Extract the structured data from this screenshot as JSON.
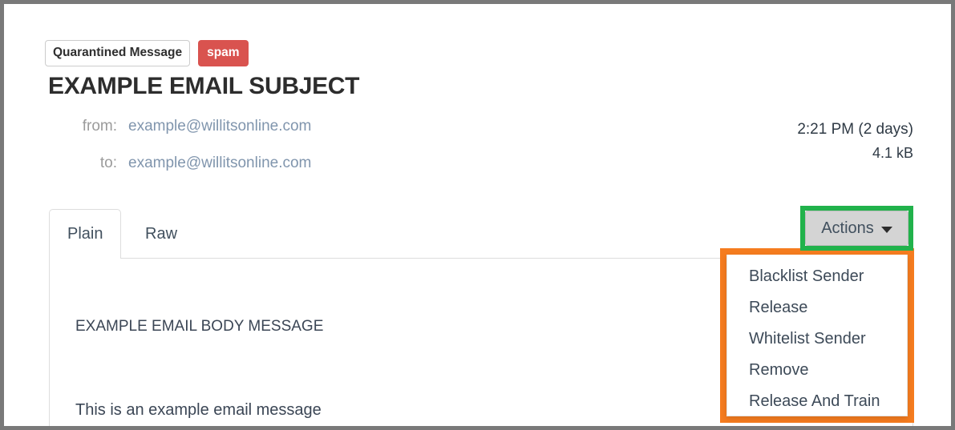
{
  "window": {
    "frame_color": "#797979",
    "background": "#ffffff"
  },
  "header": {
    "badges": [
      {
        "name": "quarantined-message-badge",
        "label": "Quarantined Message",
        "style": "outline",
        "color": "#ffffff",
        "text_color": "#2f2f2f"
      },
      {
        "name": "spam-badge",
        "label": "spam",
        "style": "solid",
        "color": "#d9534f",
        "text_color": "#ffffff"
      }
    ],
    "subject": "EXAMPLE EMAIL SUBJECT",
    "subject_color": "#2d2d2d"
  },
  "meta": {
    "from_label": "from:",
    "from_value": "example@willitsonline.com",
    "to_label": "to:",
    "to_value": "example@willitsonline.com",
    "label_color": "#9b9b9b",
    "value_color": "#8095ad"
  },
  "stamp": {
    "time": "2:21 PM (2 days)",
    "size": "4.1 kB",
    "color": "#2f3a45"
  },
  "tabs": [
    {
      "name": "tab-plain",
      "label": "Plain",
      "active": true
    },
    {
      "name": "tab-raw",
      "label": "Raw",
      "active": false
    }
  ],
  "actions": {
    "button_label": "Actions",
    "caret_icon": "caret-down-icon",
    "button_bg": "#d4d4d4",
    "highlight_color": "#21b24b",
    "expanded": true
  },
  "menu": {
    "highlight_color": "#f57c1f",
    "items": [
      {
        "name": "menu-item-blacklist-sender",
        "label": "Blacklist Sender"
      },
      {
        "name": "menu-item-release",
        "label": "Release"
      },
      {
        "name": "menu-item-whitelist-sender",
        "label": "Whitelist Sender"
      },
      {
        "name": "menu-item-remove",
        "label": "Remove"
      },
      {
        "name": "menu-item-release-and-train",
        "label": "Release And Train"
      }
    ]
  },
  "body": {
    "line_1": "EXAMPLE EMAIL BODY MESSAGE",
    "line_2": "This is an example email message",
    "text_color": "#3b4655"
  }
}
